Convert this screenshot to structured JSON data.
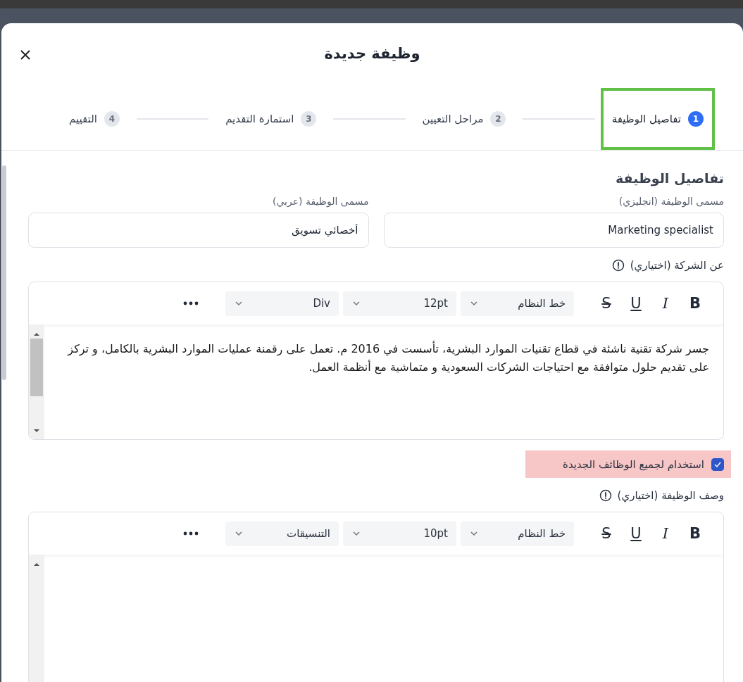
{
  "dialog": {
    "title": "وظيفة جديدة"
  },
  "steps": [
    {
      "number": "1",
      "label": "تفاصيل الوظيفة",
      "selected": true,
      "highlighted": true
    },
    {
      "number": "2",
      "label": "مراحل التعيين",
      "selected": false,
      "highlighted": false
    },
    {
      "number": "3",
      "label": "استمارة التقديم",
      "selected": false,
      "highlighted": false
    },
    {
      "number": "4",
      "label": "التقييم",
      "selected": false,
      "highlighted": false
    }
  ],
  "section_title": "تفاصيل الوظيفة",
  "fields": [
    {
      "label": "مسمى الوظيفة (انجليزي)",
      "value": "Marketing specialist"
    },
    {
      "label": "مسمى الوظيفة (عربي)",
      "value": "أخصائي تسويق"
    }
  ],
  "editors": [
    {
      "label": "عن الشركة (اختياري)",
      "format_buttons": [
        {
          "kind": "bold",
          "label": "B"
        },
        {
          "kind": "italic",
          "label": "I"
        },
        {
          "kind": "underline",
          "label": "U"
        },
        {
          "kind": "strike",
          "label": "S"
        }
      ],
      "font": "خط النظام",
      "size": "12pt",
      "block": "Div",
      "content": "جسر شركة تقنية ناشئة في قطاع تقنيات الموارد البشرية، تأسست في 2016 م. تعمل على رقمنة عمليات الموارد البشرية بالكامل، و تركز على تقديم حلول متوافقة مع احتياجات الشركات السعودية و متماشية مع أنظمة العمل."
    },
    {
      "label": "وصف الوظيفة (اختياري)",
      "format_buttons": [
        {
          "kind": "bold",
          "label": "B"
        },
        {
          "kind": "italic",
          "label": "I"
        },
        {
          "kind": "underline",
          "label": "U"
        },
        {
          "kind": "strike",
          "label": "S"
        }
      ],
      "font": "خط النظام",
      "size": "10pt",
      "block": "التنسيقات"
    }
  ],
  "checkbox": {
    "label": "استخدام لجميع الوظائف الجديدة",
    "checked": true,
    "highlighted": true
  }
}
